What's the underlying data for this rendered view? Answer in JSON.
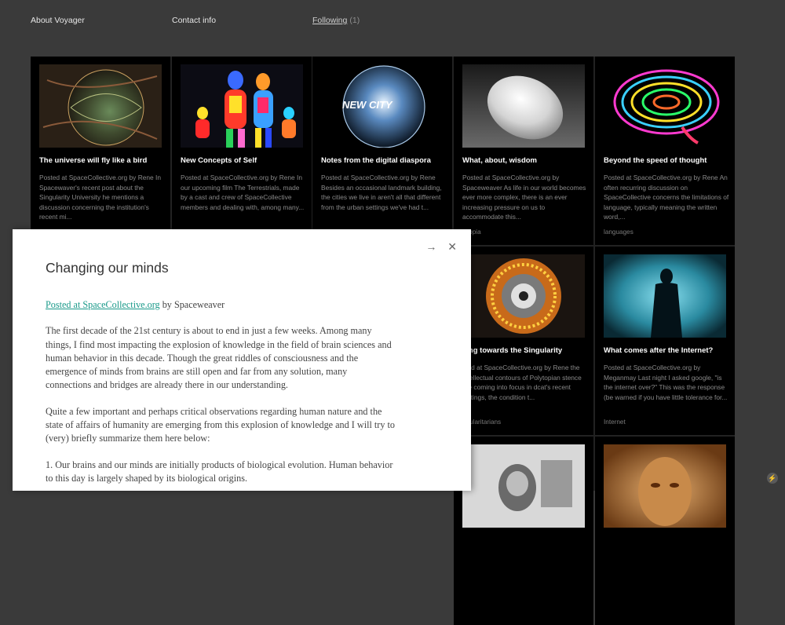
{
  "nav": {
    "about": "About Voyager",
    "contact": "Contact info",
    "following": "Following",
    "following_count": "(1)"
  },
  "tiles": [
    {
      "title": "The universe will fly like a bird",
      "excerpt": "Posted at SpaceCollective.org by Rene In Spacewaver's recent post about the Singularity University he mentions a discussion concerning the institution's recent mi...",
      "tag": ""
    },
    {
      "title": "New Concepts of Self",
      "excerpt": "Posted at SpaceCollective.org by Rene In our upcoming film The Terrestrials, made by a cast and crew of SpaceCollective members and dealing with, among many...",
      "tag": ""
    },
    {
      "title": "Notes from the digital diaspora",
      "excerpt": "Posted at SpaceCollective.org by Rene Besides an occasional landmark building, the cities we live in aren't all that different from the urban settings we've had t...",
      "tag": "",
      "image_text": "NEW CITY"
    },
    {
      "title": "What, about, wisdom",
      "excerpt": "Posted at SpaceCollective.org by Spaceweaver As life in our world becomes ever more complex, there is an ever increasing pressure on us to accommodate this...",
      "tag": "lytopia"
    },
    {
      "title": "Beyond the speed of thought",
      "excerpt": "Posted at SpaceCollective.org by Rene An often recurring discussion on SpaceCollective concerns the limitations of language, typically meaning the written word,...",
      "tag": "languages"
    },
    {
      "title": "ving towards the Singularity",
      "excerpt": "sted at SpaceCollective.org by Rene the intellectual contours of Polytopian stence are coming into focus in dcat's recent writings, the condition t...",
      "tag": "ngularitarians"
    },
    {
      "title": "What comes after the Internet?",
      "excerpt": "Posted at SpaceCollective.org by Meganmay Last night I asked google, \"is the internet over?\" This was the response (be warned if you have little tolerance for...",
      "tag": "Internet"
    }
  ],
  "overlay": {
    "title": "Changing our minds",
    "posted_link": "Posted at SpaceCollective.org",
    "posted_by": " by Spaceweaver",
    "paragraphs": [
      "The first decade of the 21st century is about to end in just a few weeks. Among many things, I find most impacting the explosion of knowledge in the field of brain sciences and human behavior in this decade. Though the great riddles of consciousness and the emergence of minds from brains are still open and far from any solution, many connections and bridges are already there in our understanding.",
      "Quite a few important and perhaps critical observations regarding human nature and the state of affairs of humanity are emerging from this explosion of knowledge and I will try to (very) briefly summarize them here below:",
      "1. Our brains and our minds are initially products of biological evolution. Human behavior to this day is largely shaped by its biological origins."
    ],
    "next_glyph": "→",
    "close_glyph": "✕"
  },
  "corner_glyph": "⚡"
}
